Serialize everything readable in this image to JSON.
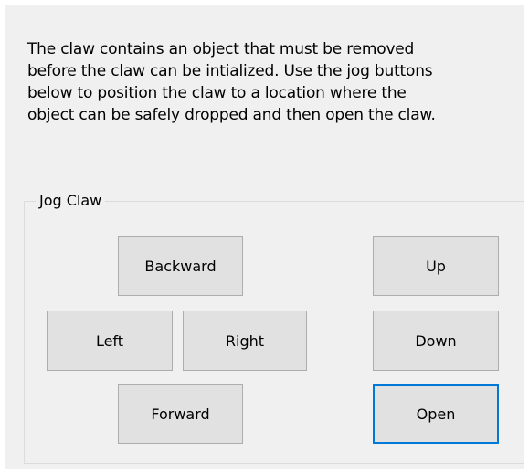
{
  "message": {
    "lines": [
      "The claw contains an object that must be removed",
      "before the claw can be intialized. Use the jog buttons",
      "below to position the claw to a location where the",
      "object can be safely dropped and then open the claw."
    ]
  },
  "jog_group": {
    "label": "Jog Claw",
    "buttons": {
      "backward": "Backward",
      "left": "Left",
      "right": "Right",
      "forward": "Forward",
      "up": "Up",
      "down": "Down",
      "open": "Open"
    },
    "default_button": "open"
  },
  "colors": {
    "dialog_background": "#f0f0f0",
    "button_face": "#e1e1e1",
    "button_border": "#adadad",
    "focus_border": "#0078d7"
  }
}
